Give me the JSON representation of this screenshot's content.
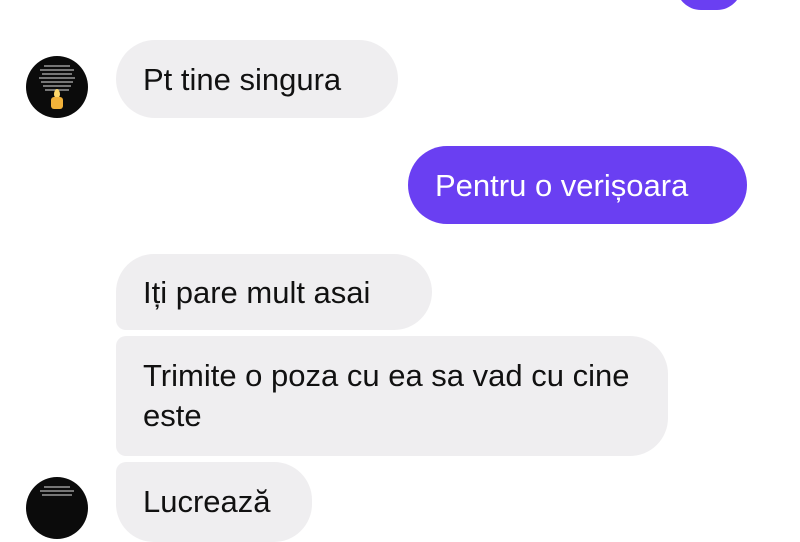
{
  "conversation": {
    "messages": [
      {
        "direction": "incoming",
        "text": "Pt tine singura"
      },
      {
        "direction": "outgoing",
        "text": "Pentru o verișoara"
      },
      {
        "direction": "incoming",
        "text": "Iți pare mult asai"
      },
      {
        "direction": "incoming",
        "text": "Trimite o poza cu ea sa vad cu cine este"
      },
      {
        "direction": "incoming",
        "text": "Lucrează"
      }
    ]
  },
  "colors": {
    "outgoing_bubble": "#6a3ff2",
    "incoming_bubble": "#efeef0",
    "background": "#ffffff"
  },
  "icons": {
    "avatar": "contact-avatar-candle-icon"
  }
}
